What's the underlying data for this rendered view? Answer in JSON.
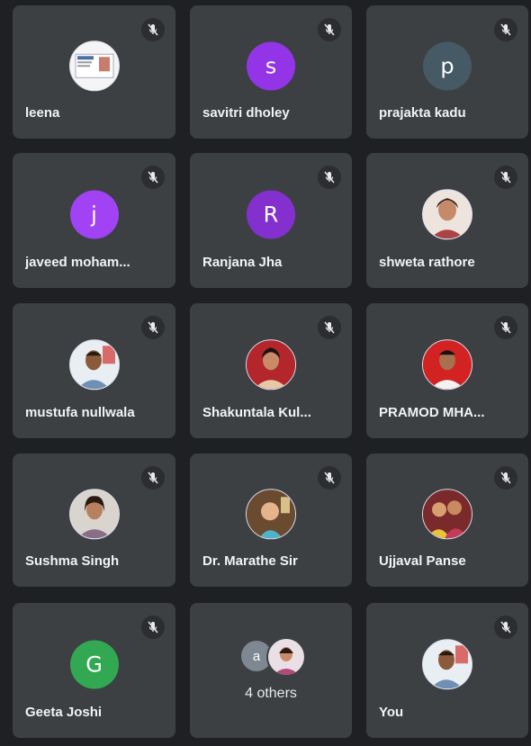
{
  "participants": [
    {
      "name": "leena",
      "avatar_type": "photo",
      "photo": "document-photo",
      "muted": true
    },
    {
      "name": "savitri dholey",
      "avatar_type": "initial",
      "initial": "s",
      "color": "#9334e6",
      "muted": true
    },
    {
      "name": "prajakta kadu",
      "avatar_type": "initial",
      "initial": "p",
      "color": "#455a64",
      "muted": true
    },
    {
      "name": "javeed moham...",
      "avatar_type": "initial",
      "initial": "j",
      "color": "#a142f4",
      "muted": true
    },
    {
      "name": "Ranjana Jha",
      "avatar_type": "initial",
      "initial": "R",
      "color": "#8430ce",
      "muted": true
    },
    {
      "name": "shweta rathore",
      "avatar_type": "photo",
      "photo": "woman-portrait",
      "muted": true
    },
    {
      "name": "mustufa nullwala",
      "avatar_type": "photo",
      "photo": "man-portrait",
      "muted": true
    },
    {
      "name": "Shakuntala Kul...",
      "avatar_type": "photo",
      "photo": "woman-red-background",
      "muted": true
    },
    {
      "name": "PRAMOD MHA...",
      "avatar_type": "photo",
      "photo": "man-red-background",
      "muted": true
    },
    {
      "name": "Sushma Singh",
      "avatar_type": "photo",
      "photo": "woman-portrait",
      "muted": true
    },
    {
      "name": "Dr. Marathe Sir",
      "avatar_type": "photo",
      "photo": "child-photo",
      "muted": true
    },
    {
      "name": "Ujjaval Panse",
      "avatar_type": "photo",
      "photo": "group-photo",
      "muted": true
    },
    {
      "name": "Geeta Joshi",
      "avatar_type": "initial",
      "initial": "G",
      "color": "#33a852",
      "muted": true
    }
  ],
  "others": {
    "label": "4 others",
    "initial": "a",
    "photo": "woman-portrait"
  },
  "you": {
    "name": "You",
    "avatar_type": "photo",
    "photo": "man-portrait",
    "muted": true
  },
  "icons": {
    "mute": "mic-off-icon"
  }
}
